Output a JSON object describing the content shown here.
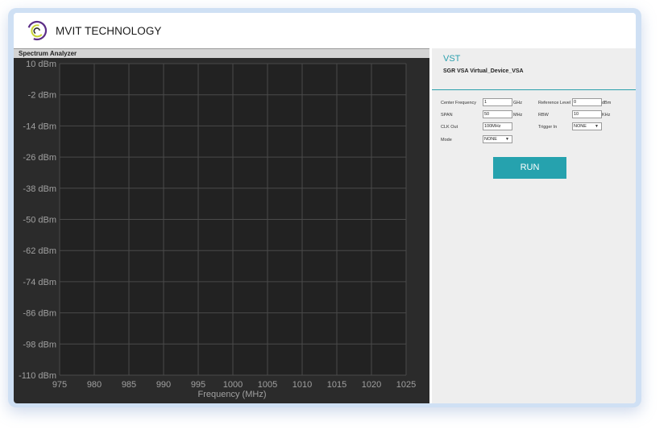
{
  "header": {
    "brand": "MVIT TECHNOLOGY",
    "logo_colors": [
      "#5b2d86",
      "#c7d334",
      "#2f2f2f"
    ]
  },
  "spectrum": {
    "title": "Spectrum Analyzer"
  },
  "chart_data": {
    "type": "line",
    "title": "",
    "xlabel": "Frequency (MHz)",
    "ylabel": "",
    "xlim": [
      975,
      1025
    ],
    "ylim": [
      -110,
      10
    ],
    "x_ticks": [
      975,
      980,
      985,
      990,
      995,
      1000,
      1005,
      1010,
      1015,
      1020,
      1025
    ],
    "y_ticks": [
      10,
      -2,
      -14,
      -26,
      -38,
      -50,
      -62,
      -74,
      -86,
      -98,
      -110
    ],
    "y_tick_labels": [
      "10 dBm",
      "-2 dBm",
      "-14 dBm",
      "-26 dBm",
      "-38 dBm",
      "-50 dBm",
      "-62 dBm",
      "-74 dBm",
      "-86 dBm",
      "-98 dBm",
      "-110 dBm"
    ],
    "grid": true,
    "series": []
  },
  "config": {
    "section_title": "VST",
    "device_name": "SGR VSA Virtual_Device_VSA",
    "center_frequency": {
      "label": "Center Frequency",
      "value": "1",
      "unit": "GHz"
    },
    "reference_level": {
      "label": "Reference Level",
      "value": "0",
      "unit": "dBm"
    },
    "span": {
      "label": "SPAN",
      "value": "50",
      "unit": "MHz"
    },
    "rbw": {
      "label": "RBW",
      "value": "10",
      "unit": "KHz"
    },
    "clk_out": {
      "label": "CLK Out",
      "value": "100MHz"
    },
    "trigger_in": {
      "label": "Trigger In",
      "value": "NONE"
    },
    "mode": {
      "label": "Mode",
      "value": "NONE"
    },
    "run_label": "RUN",
    "accent_color": "#26a2ae"
  }
}
